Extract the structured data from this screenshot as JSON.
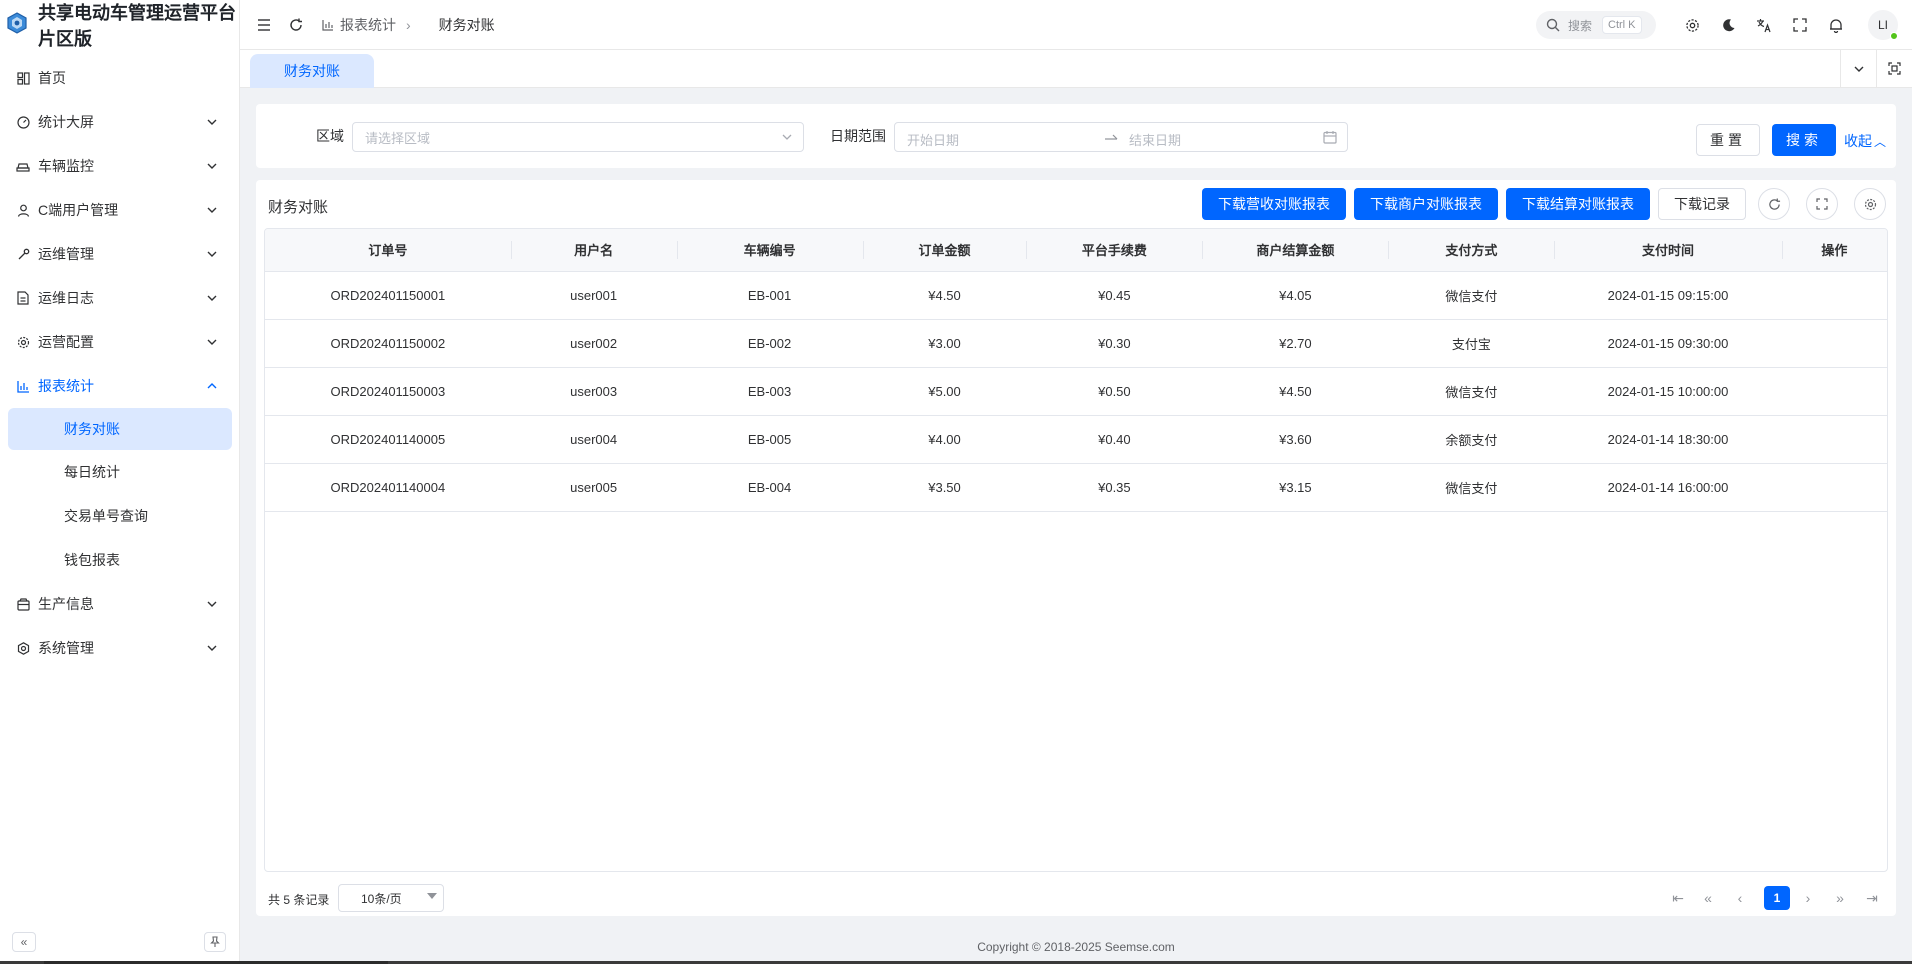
{
  "app": {
    "title": "共享电动车管理运营平台片区版",
    "avatar_initials": "LI"
  },
  "sidebar": {
    "items": [
      {
        "label": "首页",
        "icon": "dashboard-icon",
        "expandable": false
      },
      {
        "label": "统计大屏",
        "icon": "gauge-icon",
        "expandable": true
      },
      {
        "label": "车辆监控",
        "icon": "car-icon",
        "expandable": true
      },
      {
        "label": "C端用户管理",
        "icon": "user-icon",
        "expandable": true
      },
      {
        "label": "运维管理",
        "icon": "wrench-icon",
        "expandable": true
      },
      {
        "label": "运维日志",
        "icon": "file-icon",
        "expandable": true
      },
      {
        "label": "运营配置",
        "icon": "gear-icon",
        "expandable": true
      },
      {
        "label": "报表统计",
        "icon": "bar-chart-icon",
        "expandable": true,
        "expanded": true
      },
      {
        "label": "生产信息",
        "icon": "box-icon",
        "expandable": true
      },
      {
        "label": "系统管理",
        "icon": "settings-icon",
        "expandable": true
      }
    ],
    "report_children": [
      "财务对账",
      "每日统计",
      "交易单号查询",
      "钱包报表"
    ]
  },
  "header": {
    "breadcrumb_parent": "报表统计",
    "breadcrumb_current": "财务对账",
    "search_label": "搜索",
    "search_shortcut": "Ctrl K"
  },
  "tabs": {
    "active": "财务对账"
  },
  "filter": {
    "region_label": "区域",
    "region_placeholder": "请选择区域",
    "date_label": "日期范围",
    "start_placeholder": "开始日期",
    "end_placeholder": "结束日期",
    "reset_label": "重置",
    "search_label": "搜索",
    "fold_label": "收起"
  },
  "table_card": {
    "title": "财务对账",
    "btn_revenue": "下载营收对账报表",
    "btn_merchant": "下载商户对账报表",
    "btn_settlement": "下载结算对账报表",
    "btn_history": "下载记录",
    "columns": [
      "订单号",
      "用户名",
      "车辆编号",
      "订单金额",
      "平台手续费",
      "商户结算金额",
      "支付方式",
      "支付时间",
      "操作"
    ],
    "rows": [
      [
        "ORD202401150001",
        "user001",
        "EB-001",
        "¥4.50",
        "¥0.45",
        "¥4.05",
        "微信支付",
        "2024-01-15 09:15:00",
        ""
      ],
      [
        "ORD202401150002",
        "user002",
        "EB-002",
        "¥3.00",
        "¥0.30",
        "¥2.70",
        "支付宝",
        "2024-01-15 09:30:00",
        ""
      ],
      [
        "ORD202401150003",
        "user003",
        "EB-003",
        "¥5.00",
        "¥0.50",
        "¥4.50",
        "微信支付",
        "2024-01-15 10:00:00",
        ""
      ],
      [
        "ORD202401140005",
        "user004",
        "EB-005",
        "¥4.00",
        "¥0.40",
        "¥3.60",
        "余额支付",
        "2024-01-14 18:30:00",
        ""
      ],
      [
        "ORD202401140004",
        "user005",
        "EB-004",
        "¥3.50",
        "¥0.35",
        "¥3.15",
        "微信支付",
        "2024-01-14 16:00:00",
        ""
      ]
    ]
  },
  "pagination": {
    "total_text": "共 5 条记录",
    "page_size": "10条/页",
    "current_page": "1"
  },
  "footer": {
    "copyright": "Copyright © 2018-2025 Seemse.com"
  },
  "colors": {
    "primary": "#0066ff",
    "active_bg": "#dbe8ff"
  }
}
